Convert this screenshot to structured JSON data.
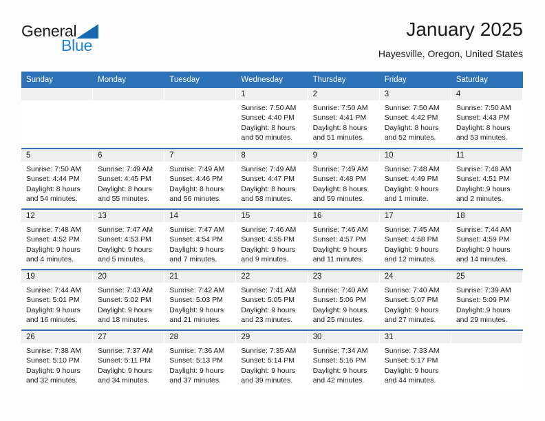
{
  "brand": {
    "line1": "General",
    "line2": "Blue",
    "triangle_color": "#1569b0",
    "line2_color": "#1f82d8",
    "icon": "triangle-logo-icon"
  },
  "header": {
    "title": "January 2025",
    "subtitle": "Hayesville, Oregon, United States"
  },
  "theme": {
    "header_blue": "#2e72b8",
    "daynum_band": "#efefef",
    "page_background": "#fdfdfd",
    "text": "#1a1a1a"
  },
  "calendar": {
    "weekday_headers": [
      "Sunday",
      "Monday",
      "Tuesday",
      "Wednesday",
      "Thursday",
      "Friday",
      "Saturday"
    ],
    "weeks": [
      [
        {
          "day": "",
          "lines": []
        },
        {
          "day": "",
          "lines": []
        },
        {
          "day": "",
          "lines": []
        },
        {
          "day": "1",
          "lines": [
            "Sunrise: 7:50 AM",
            "Sunset: 4:40 PM",
            "Daylight: 8 hours",
            "and 50 minutes."
          ]
        },
        {
          "day": "2",
          "lines": [
            "Sunrise: 7:50 AM",
            "Sunset: 4:41 PM",
            "Daylight: 8 hours",
            "and 51 minutes."
          ]
        },
        {
          "day": "3",
          "lines": [
            "Sunrise: 7:50 AM",
            "Sunset: 4:42 PM",
            "Daylight: 8 hours",
            "and 52 minutes."
          ]
        },
        {
          "day": "4",
          "lines": [
            "Sunrise: 7:50 AM",
            "Sunset: 4:43 PM",
            "Daylight: 8 hours",
            "and 53 minutes."
          ]
        }
      ],
      [
        {
          "day": "5",
          "lines": [
            "Sunrise: 7:50 AM",
            "Sunset: 4:44 PM",
            "Daylight: 8 hours",
            "and 54 minutes."
          ]
        },
        {
          "day": "6",
          "lines": [
            "Sunrise: 7:49 AM",
            "Sunset: 4:45 PM",
            "Daylight: 8 hours",
            "and 55 minutes."
          ]
        },
        {
          "day": "7",
          "lines": [
            "Sunrise: 7:49 AM",
            "Sunset: 4:46 PM",
            "Daylight: 8 hours",
            "and 56 minutes."
          ]
        },
        {
          "day": "8",
          "lines": [
            "Sunrise: 7:49 AM",
            "Sunset: 4:47 PM",
            "Daylight: 8 hours",
            "and 58 minutes."
          ]
        },
        {
          "day": "9",
          "lines": [
            "Sunrise: 7:49 AM",
            "Sunset: 4:48 PM",
            "Daylight: 8 hours",
            "and 59 minutes."
          ]
        },
        {
          "day": "10",
          "lines": [
            "Sunrise: 7:48 AM",
            "Sunset: 4:49 PM",
            "Daylight: 9 hours",
            "and 1 minute."
          ]
        },
        {
          "day": "11",
          "lines": [
            "Sunrise: 7:48 AM",
            "Sunset: 4:51 PM",
            "Daylight: 9 hours",
            "and 2 minutes."
          ]
        }
      ],
      [
        {
          "day": "12",
          "lines": [
            "Sunrise: 7:48 AM",
            "Sunset: 4:52 PM",
            "Daylight: 9 hours",
            "and 4 minutes."
          ]
        },
        {
          "day": "13",
          "lines": [
            "Sunrise: 7:47 AM",
            "Sunset: 4:53 PM",
            "Daylight: 9 hours",
            "and 5 minutes."
          ]
        },
        {
          "day": "14",
          "lines": [
            "Sunrise: 7:47 AM",
            "Sunset: 4:54 PM",
            "Daylight: 9 hours",
            "and 7 minutes."
          ]
        },
        {
          "day": "15",
          "lines": [
            "Sunrise: 7:46 AM",
            "Sunset: 4:55 PM",
            "Daylight: 9 hours",
            "and 9 minutes."
          ]
        },
        {
          "day": "16",
          "lines": [
            "Sunrise: 7:46 AM",
            "Sunset: 4:57 PM",
            "Daylight: 9 hours",
            "and 11 minutes."
          ]
        },
        {
          "day": "17",
          "lines": [
            "Sunrise: 7:45 AM",
            "Sunset: 4:58 PM",
            "Daylight: 9 hours",
            "and 12 minutes."
          ]
        },
        {
          "day": "18",
          "lines": [
            "Sunrise: 7:44 AM",
            "Sunset: 4:59 PM",
            "Daylight: 9 hours",
            "and 14 minutes."
          ]
        }
      ],
      [
        {
          "day": "19",
          "lines": [
            "Sunrise: 7:44 AM",
            "Sunset: 5:01 PM",
            "Daylight: 9 hours",
            "and 16 minutes."
          ]
        },
        {
          "day": "20",
          "lines": [
            "Sunrise: 7:43 AM",
            "Sunset: 5:02 PM",
            "Daylight: 9 hours",
            "and 18 minutes."
          ]
        },
        {
          "day": "21",
          "lines": [
            "Sunrise: 7:42 AM",
            "Sunset: 5:03 PM",
            "Daylight: 9 hours",
            "and 21 minutes."
          ]
        },
        {
          "day": "22",
          "lines": [
            "Sunrise: 7:41 AM",
            "Sunset: 5:05 PM",
            "Daylight: 9 hours",
            "and 23 minutes."
          ]
        },
        {
          "day": "23",
          "lines": [
            "Sunrise: 7:40 AM",
            "Sunset: 5:06 PM",
            "Daylight: 9 hours",
            "and 25 minutes."
          ]
        },
        {
          "day": "24",
          "lines": [
            "Sunrise: 7:40 AM",
            "Sunset: 5:07 PM",
            "Daylight: 9 hours",
            "and 27 minutes."
          ]
        },
        {
          "day": "25",
          "lines": [
            "Sunrise: 7:39 AM",
            "Sunset: 5:09 PM",
            "Daylight: 9 hours",
            "and 29 minutes."
          ]
        }
      ],
      [
        {
          "day": "26",
          "lines": [
            "Sunrise: 7:38 AM",
            "Sunset: 5:10 PM",
            "Daylight: 9 hours",
            "and 32 minutes."
          ]
        },
        {
          "day": "27",
          "lines": [
            "Sunrise: 7:37 AM",
            "Sunset: 5:11 PM",
            "Daylight: 9 hours",
            "and 34 minutes."
          ]
        },
        {
          "day": "28",
          "lines": [
            "Sunrise: 7:36 AM",
            "Sunset: 5:13 PM",
            "Daylight: 9 hours",
            "and 37 minutes."
          ]
        },
        {
          "day": "29",
          "lines": [
            "Sunrise: 7:35 AM",
            "Sunset: 5:14 PM",
            "Daylight: 9 hours",
            "and 39 minutes."
          ]
        },
        {
          "day": "30",
          "lines": [
            "Sunrise: 7:34 AM",
            "Sunset: 5:16 PM",
            "Daylight: 9 hours",
            "and 42 minutes."
          ]
        },
        {
          "day": "31",
          "lines": [
            "Sunrise: 7:33 AM",
            "Sunset: 5:17 PM",
            "Daylight: 9 hours",
            "and 44 minutes."
          ]
        },
        {
          "day": "",
          "lines": []
        }
      ]
    ]
  }
}
